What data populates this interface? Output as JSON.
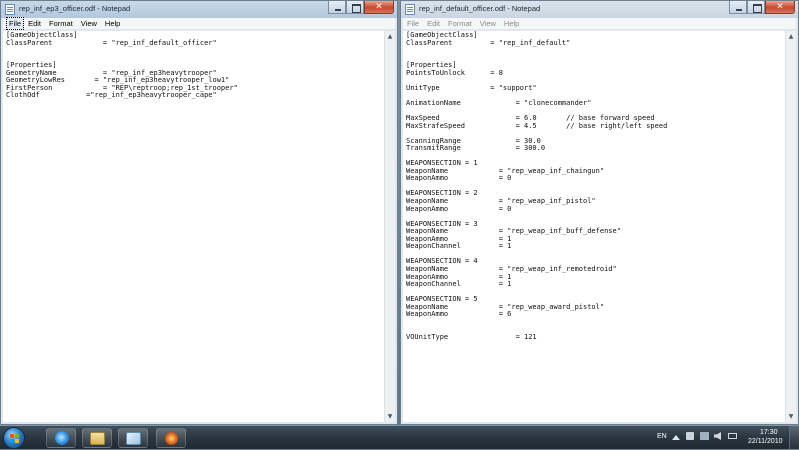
{
  "left_window": {
    "title": "rep_inf_ep3_officer.odf - Notepad",
    "menu": [
      "File",
      "Edit",
      "Format",
      "View",
      "Help"
    ],
    "lines": [
      "[GameObjectClass]",
      "ClassParent            = \"rep_inf_default_officer\"",
      "",
      "",
      "[Properties]",
      "GeometryName           = \"rep_inf_ep3heavytrooper\"",
      "GeometryLowRes       = \"rep_inf_ep3heavytrooper_low1\"",
      "FirstPerson            = \"REP\\reptroop;rep_1st_trooper\"",
      "ClothOdf           =\"rep_inf_ep3heavytrooper_cape\""
    ]
  },
  "right_window": {
    "title": "rep_inf_default_officer.odf - Notepad",
    "menu": [
      "File",
      "Edit",
      "Format",
      "View",
      "Help"
    ],
    "lines": [
      "[GameObjectClass]",
      "ClassParent         = \"rep_inf_default\"",
      "",
      "",
      "[Properties]",
      "PointsToUnlock      = 8",
      "",
      "UnitType            = \"support\"",
      "",
      "AnimationName             = \"clonecommander\"",
      "",
      "MaxSpeed                  = 6.0       // base forward speed",
      "MaxStrafeSpeed            = 4.5       // base right/left speed",
      "",
      "ScanningRange             = 30.0",
      "TransmitRange             = 300.0",
      "",
      "WEAPONSECTION = 1",
      "WeaponName            = \"rep_weap_inf_chaingun\"",
      "WeaponAmmo            = 0",
      "",
      "WEAPONSECTION = 2",
      "WeaponName            = \"rep_weap_inf_pistol\"",
      "WeaponAmmo            = 0",
      "",
      "WEAPONSECTION = 3",
      "WeaponName            = \"rep_weap_inf_buff_defense\"",
      "WeaponAmmo            = 1",
      "WeaponChannel         = 1",
      "",
      "WEAPONSECTION = 4",
      "WeaponName            = \"rep_weap_inf_remotedroid\"",
      "WeaponAmmo            = 1",
      "WeaponChannel         = 1",
      "",
      "WEAPONSECTION = 5",
      "WeaponName            = \"rep_weap_award_pistol\"",
      "WeaponAmmo            = 6",
      "",
      "",
      "VOUnitType                = 121"
    ]
  },
  "taskbar": {
    "language": "EN",
    "time": "17:30",
    "date": "22/11/2010",
    "pinned_icons": [
      "internet-explorer-icon",
      "file-explorer-icon",
      "notepad-icon",
      "game-icon"
    ]
  },
  "colors": {
    "close_button": "#c9462c",
    "start_orb": "#2e7fc7"
  }
}
